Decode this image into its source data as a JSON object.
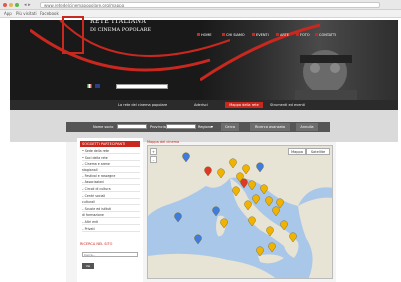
{
  "browser": {
    "url": "www.retedelcinemapopolare.org/mappa",
    "bookmarks": [
      "App",
      "Più visitati",
      "Facebook"
    ]
  },
  "header": {
    "logo_title": "RETE ITALIANA",
    "logo_subtitle": "DI CINEMA POPOLARE",
    "nav": [
      "HOME",
      "CHI SIAMO",
      "EVENTI",
      "ARTE",
      "FOTO",
      "CONTATTI"
    ],
    "search_placeholder": ""
  },
  "menu": {
    "items": [
      "La rete del cinema popolare",
      "Aderisci",
      "Strumenti ed eventi"
    ],
    "active": "Mappa della rete"
  },
  "filters": {
    "label_name": "Nome socio",
    "label_province": "Provincia",
    "label_region": "Regione",
    "button_search": "Cerca",
    "button_advanced": "Ricerca avanzata",
    "button_reset": "Annulla"
  },
  "sidebar": {
    "heading": "SOGGETTI PARTECIPANTI",
    "items": [
      "• Sede della rete",
      "• Soci della rete",
      "  – Cinema e arene",
      "    stagionali",
      "  – Festival e rassegne",
      "  – Associazioni",
      "    – Circoli di cultura",
      "    – Centri sociali",
      "      culturali",
      "    – Scuole ed istituti",
      "      di formazione",
      "    – Altri enti",
      "    – Privati"
    ],
    "heading2": "RICERCA NEL SITO",
    "search_value": "Cerca...",
    "search_button": "Vai"
  },
  "map": {
    "title": "Mappa del cinema",
    "zoom_in": "+",
    "zoom_out": "–",
    "type_map": "Mappa",
    "type_sat": "Satellite",
    "colors": {
      "sea": "#a9c7e8",
      "land": "#e7e3d5",
      "marker_gold": "#f0b400",
      "marker_red": "#e0362a",
      "marker_blue": "#3e7ce0",
      "brand_red": "#c8281e"
    }
  }
}
